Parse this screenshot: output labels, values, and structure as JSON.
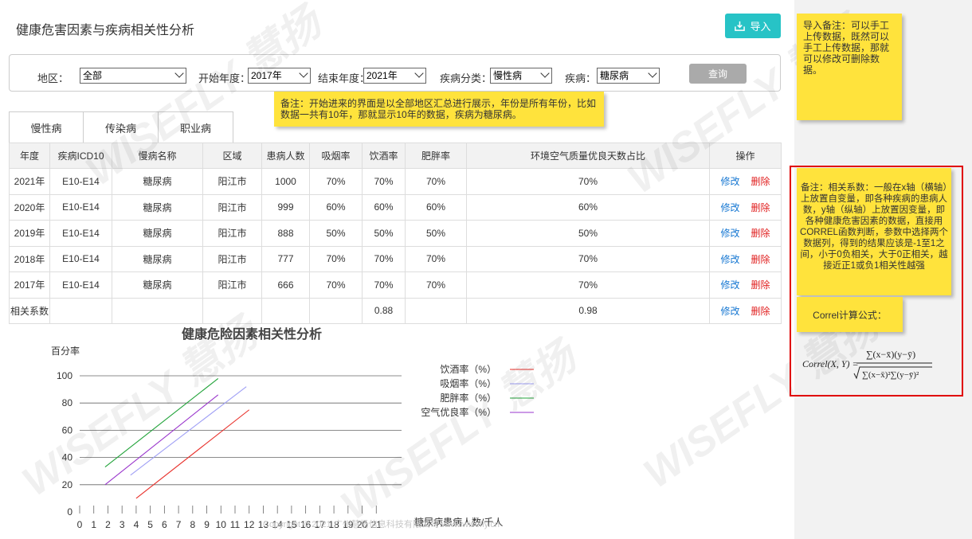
{
  "page": {
    "title": "健康危害因素与疾病相关性分析",
    "import_label": "导入"
  },
  "filters": {
    "region_label": "地区：",
    "region_value": "全部",
    "start_label": "开始年度：",
    "start_value": "2017年",
    "end_label": "结束年度：",
    "end_value": "2021年",
    "category_label": "疾病分类：",
    "category_value": "慢性病",
    "disease_label": "疾病：",
    "disease_value": "糖尿病",
    "query_label": "查询"
  },
  "notes": {
    "note1": "备注：开始进来的界面是以全部地区汇总进行展示，年份是所有年份，比如数据一共有10年，那就显示10年的数据，疾病为糖尿病。",
    "note2": "导入备注：可以手工上传数据，既然可以手工上传数据，那就可以修改可删除数据。",
    "note3": "备注：相关系数：一般在x轴（横轴）上放置自变量，即各种疾病的患病人数，y轴（纵轴）上放置因变量，即各种健康危害因素的数据，直接用CORREL函数判断，参数中选择两个数据列，得到的结果应该是-1至1之间，小于0负相关，大于0正相关，越接近正1或负1相关性越强",
    "note4": "Correl计算公式：",
    "formula_lhs": "Correl(X, Y) =",
    "formula_num": "∑(x−x̄)(y−ȳ)",
    "formula_den": "∑(x−x̄)²∑(y−ȳ)²"
  },
  "tabs": [
    "慢性病",
    "传染病",
    "职业病"
  ],
  "table": {
    "headers": [
      "年度",
      "疾病ICD10",
      "慢病名称",
      "区域",
      "患病人数",
      "吸烟率",
      "饮酒率",
      "肥胖率",
      "环境空气质量优良天数占比",
      "操作"
    ],
    "rows": [
      [
        "2021年",
        "E10-E14",
        "糖尿病",
        "阳江市",
        "1000",
        "70%",
        "70%",
        "70%",
        "70%"
      ],
      [
        "2020年",
        "E10-E14",
        "糖尿病",
        "阳江市",
        "999",
        "60%",
        "60%",
        "60%",
        "60%"
      ],
      [
        "2019年",
        "E10-E14",
        "糖尿病",
        "阳江市",
        "888",
        "50%",
        "50%",
        "50%",
        "50%"
      ],
      [
        "2018年",
        "E10-E14",
        "糖尿病",
        "阳江市",
        "777",
        "70%",
        "70%",
        "70%",
        "70%"
      ],
      [
        "2017年",
        "E10-E14",
        "糖尿病",
        "阳江市",
        "666",
        "70%",
        "70%",
        "70%",
        "70%"
      ]
    ],
    "corr_row": {
      "label": "相关系数",
      "drink": "0.88",
      "air": "0.98"
    },
    "edit_label": "修改",
    "delete_label": "删除"
  },
  "chart_data": {
    "type": "line",
    "title": "健康危险因素相关性分析",
    "ylabel": "百分率",
    "xlabel": "糖尿病患病人数/千人",
    "xlim": [
      0,
      22
    ],
    "ylim": [
      0,
      100
    ],
    "x_ticks": [
      0,
      1,
      2,
      3,
      4,
      5,
      6,
      7,
      8,
      9,
      10,
      11,
      12,
      13,
      14,
      15,
      16,
      17,
      18,
      19,
      20,
      21
    ],
    "y_ticks": [
      0,
      20,
      40,
      60,
      80,
      100
    ],
    "grid": true,
    "legend": "top-right",
    "series": [
      {
        "name": "饮酒率（%）",
        "color": "#e8302a",
        "points": [
          [
            4,
            10
          ],
          [
            12,
            75
          ]
        ]
      },
      {
        "name": "吸烟率（%）",
        "color": "#9f9ff5",
        "points": [
          [
            3.6,
            27
          ],
          [
            11.8,
            92
          ]
        ]
      },
      {
        "name": "肥胖率（%）",
        "color": "#22a33a",
        "points": [
          [
            1.8,
            33
          ],
          [
            9.8,
            98
          ]
        ]
      },
      {
        "name": "空气优良率（%）",
        "color": "#9a36cc",
        "points": [
          [
            1.8,
            20
          ],
          [
            9.8,
            86
          ]
        ]
      }
    ]
  },
  "footer": "Copyright © 2021 广州慧扬信息科技有限公司 www.wisefly.cn",
  "watermark": "WISEFLY 慧扬"
}
